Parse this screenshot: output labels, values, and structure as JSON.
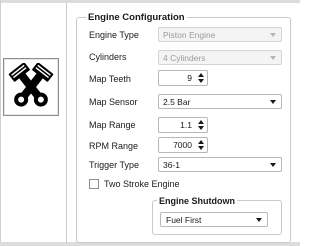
{
  "engine_config": {
    "title": "Engine Configuration",
    "fields": {
      "engine_type": {
        "label": "Engine Type",
        "value": "Piston Engine"
      },
      "cylinders": {
        "label": "Cylinders",
        "value": "4 Cylinders"
      },
      "map_teeth": {
        "label": "Map Teeth",
        "value": "9"
      },
      "map_sensor": {
        "label": "Map Sensor",
        "value": "2.5 Bar"
      },
      "map_range": {
        "label": "Map Range",
        "value": "1.1"
      },
      "rpm_range": {
        "label": "RPM Range",
        "value": "7000"
      },
      "trigger_type": {
        "label": "Trigger Type",
        "value": "36-1"
      }
    },
    "two_stroke": {
      "label": "Two Stroke Engine",
      "checked": false
    },
    "shutdown": {
      "title": "Engine Shutdown",
      "value": "Fuel First"
    }
  },
  "icons": {
    "engine": "piston-engine-icon"
  }
}
